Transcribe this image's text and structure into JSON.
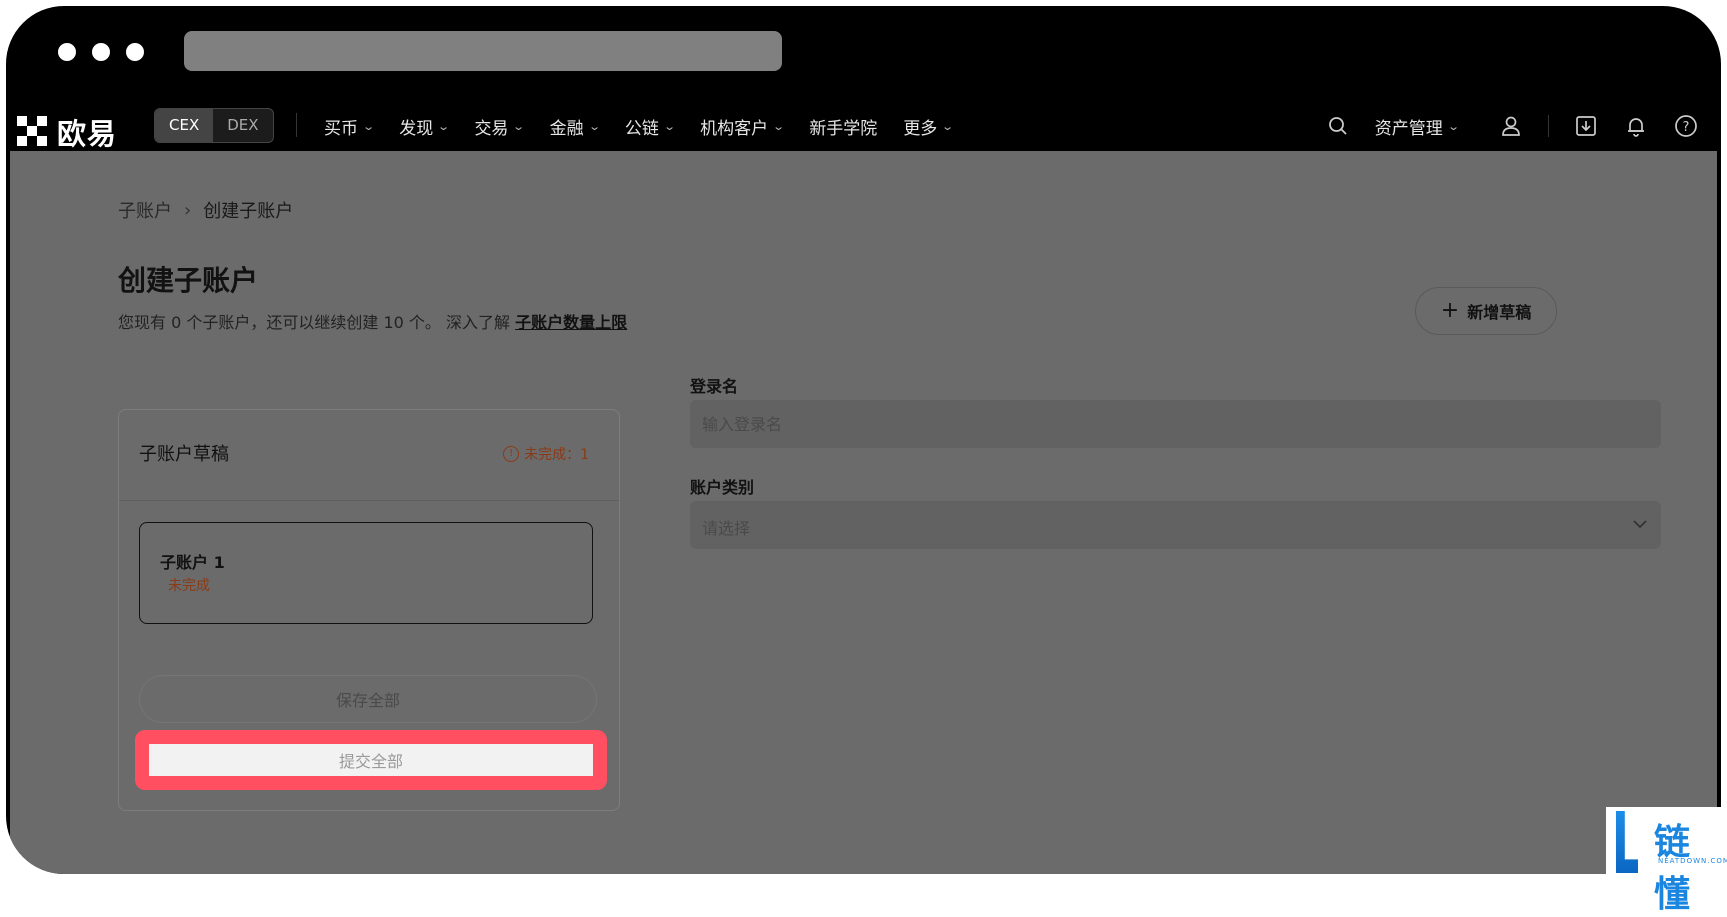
{
  "brand": {
    "logo_text": "欧易"
  },
  "nav": {
    "cex": "CEX",
    "dex": "DEX",
    "menu": [
      {
        "label": "买币",
        "dropdown": true
      },
      {
        "label": "发现",
        "dropdown": true
      },
      {
        "label": "交易",
        "dropdown": true
      },
      {
        "label": "金融",
        "dropdown": true
      },
      {
        "label": "公链",
        "dropdown": true
      },
      {
        "label": "机构客户",
        "dropdown": true
      },
      {
        "label": "新手学院",
        "dropdown": false
      },
      {
        "label": "更多",
        "dropdown": true
      }
    ],
    "asset_mgmt": "资产管理",
    "icons": [
      "search-icon",
      "user-icon",
      "download-icon",
      "bell-icon",
      "help-icon"
    ]
  },
  "breadcrumb": {
    "parent": "子账户",
    "current": "创建子账户"
  },
  "page": {
    "title": "创建子账户",
    "subtitle_text": "您现有 0 个子账户，还可以继续创建 10 个。 深入了解",
    "subtitle_link": "子账户数量上限",
    "add_draft": "新增草稿"
  },
  "drafts": {
    "title": "子账户草稿",
    "incomplete_badge": "未完成：1",
    "items": [
      {
        "name": "子账户 1",
        "status": "未完成"
      }
    ],
    "save_all": "保存全部",
    "submit_all": "提交全部"
  },
  "form": {
    "login_label": "登录名",
    "login_placeholder": "输入登录名",
    "type_label": "账户类别",
    "type_placeholder": "请选择"
  },
  "watermark": {
    "text": "链懂",
    "sub": "NEATDOWN.COM"
  },
  "colors": {
    "highlight": "#ff4f61",
    "warning": "#8a3a16",
    "overlay": "#6b6b6b"
  }
}
